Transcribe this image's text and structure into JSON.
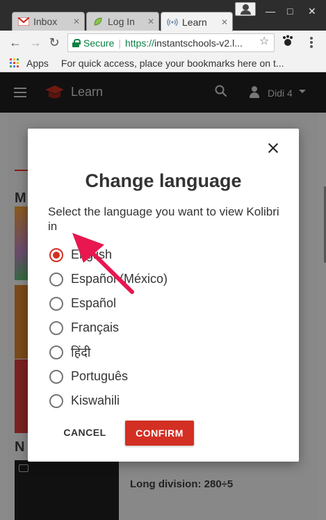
{
  "browser": {
    "tabs": [
      {
        "title": "Inbox",
        "icon": "gmail-icon",
        "active": false
      },
      {
        "title": "Log In",
        "icon": "leaf-icon",
        "active": false
      },
      {
        "title": "Learn",
        "icon": "broadcast-icon",
        "active": true
      }
    ],
    "window_controls": {
      "minimize": "—",
      "maximize": "□",
      "close": "✕"
    },
    "nav": {
      "back": "←",
      "forward": "→",
      "reload": "↻"
    },
    "address": {
      "secure_label": "Secure",
      "url_scheme": "https://",
      "url_rest": "instantschools-v2.l..."
    },
    "bookmarks_bar": {
      "apps_label": "Apps",
      "hint": "For quick access, place your bookmarks here on t..."
    }
  },
  "app": {
    "title": "Learn",
    "user_name": "Didi 4",
    "background_heading_1": "M",
    "background_heading_2": "N",
    "background_video_title": "Long division: 280÷5"
  },
  "modal": {
    "title": "Change language",
    "description": "Select the language you want to view Kolibri in",
    "options": [
      {
        "label": "English",
        "checked": true
      },
      {
        "label": "Español (México)",
        "checked": false
      },
      {
        "label": "Español",
        "checked": false
      },
      {
        "label": "Français",
        "checked": false
      },
      {
        "label": "हिंदी",
        "checked": false
      },
      {
        "label": "Português",
        "checked": false
      },
      {
        "label": "Kiswahili",
        "checked": false
      }
    ],
    "cancel_label": "CANCEL",
    "confirm_label": "CONFIRM"
  },
  "colors": {
    "accent": "#d32f23",
    "secure_green": "#0b8043",
    "annotation_arrow": "#e8174f"
  }
}
